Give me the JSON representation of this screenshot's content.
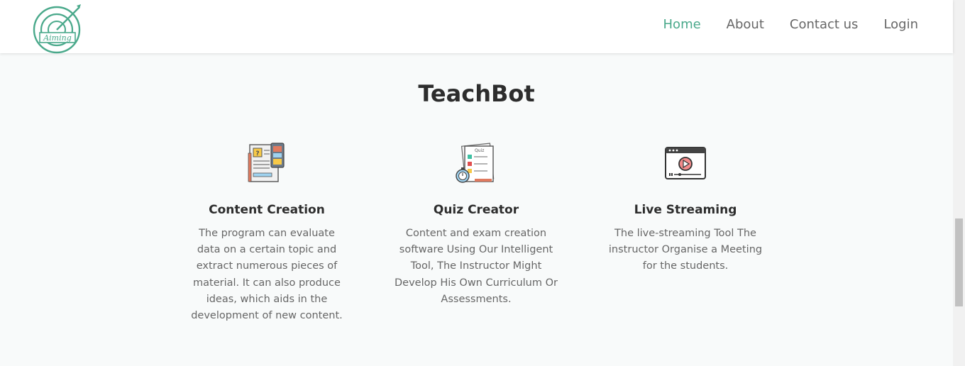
{
  "logo": {
    "text": "Aiming"
  },
  "nav": {
    "items": [
      {
        "label": "Home"
      },
      {
        "label": "About"
      },
      {
        "label": "Contact us"
      },
      {
        "label": "Login"
      }
    ],
    "active_color": "#4aa98b"
  },
  "section": {
    "title": "TeachBot",
    "features": [
      {
        "icon": "content-document-icon",
        "title": "Content Creation",
        "text": "The program can evaluate data on a certain topic and extract numerous pieces of material. It can also produce ideas, which aids in the development of new content."
      },
      {
        "icon": "quiz-stopwatch-icon",
        "title": "Quiz Creator",
        "text": "Content and exam creation software Using Our Intelligent Tool, The Instructor Might Develop His Own Curriculum Or Assessments."
      },
      {
        "icon": "video-player-icon",
        "title": "Live Streaming",
        "text": "The live-streaming Tool The instructor Organise a Meeting for the students."
      }
    ]
  },
  "colors": {
    "brand": "#4aa98b",
    "background": "#f8fafa",
    "heading": "#2d2d2d",
    "body_text": "#666666"
  }
}
